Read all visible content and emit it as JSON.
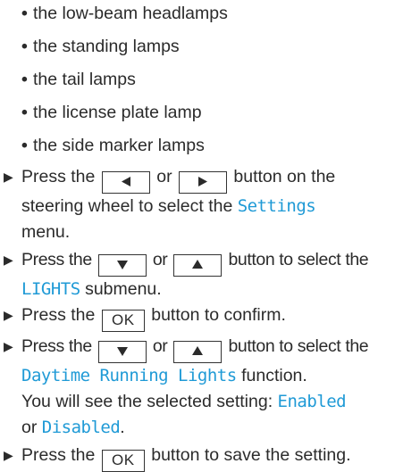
{
  "bullets": [
    "the low-beam headlamps",
    "the standing lamps",
    "the tail lamps",
    "the license plate lamp",
    "the side marker lamps"
  ],
  "steps": [
    {
      "a": "Press the",
      "or": "or",
      "b": "button on the",
      "c": "steering wheel to select the",
      "display": "Settings",
      "d": "menu."
    },
    {
      "a": "Press the",
      "or": "or",
      "b": "button to select the",
      "display": "LIGHTS",
      "c": "submenu."
    },
    {
      "a": "Press the",
      "key": "OK",
      "b": "button to confirm."
    },
    {
      "a": "Press the",
      "or": "or",
      "b": "button to select the",
      "display": "Daytime Running Lights",
      "c": "function.",
      "d": "You will see the selected setting:",
      "option1": "Enabled",
      "or2": "or",
      "option2": "Disabled",
      "end": "."
    },
    {
      "a": "Press the",
      "key": "OK",
      "b": "button to save the setting."
    }
  ],
  "colors": {
    "text": "#2b2b2b",
    "display_text": "#1f9ad6"
  },
  "icons": {
    "bullet_marker": "triangle-right",
    "keys": [
      "arrow-left",
      "arrow-right",
      "arrow-down",
      "arrow-up"
    ]
  }
}
